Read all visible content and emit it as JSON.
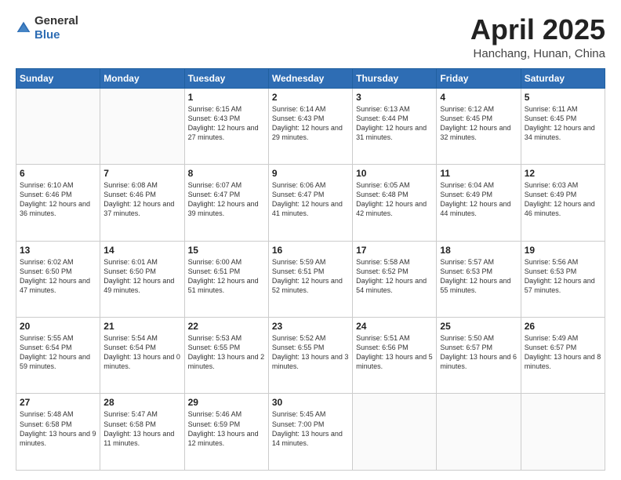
{
  "header": {
    "logo_general": "General",
    "logo_blue": "Blue",
    "title": "April 2025",
    "location": "Hanchang, Hunan, China"
  },
  "weekdays": [
    "Sunday",
    "Monday",
    "Tuesday",
    "Wednesday",
    "Thursday",
    "Friday",
    "Saturday"
  ],
  "weeks": [
    [
      {
        "day": "",
        "sunrise": "",
        "sunset": "",
        "daylight": "",
        "empty": true
      },
      {
        "day": "",
        "sunrise": "",
        "sunset": "",
        "daylight": "",
        "empty": true
      },
      {
        "day": "1",
        "sunrise": "Sunrise: 6:15 AM",
        "sunset": "Sunset: 6:43 PM",
        "daylight": "Daylight: 12 hours and 27 minutes."
      },
      {
        "day": "2",
        "sunrise": "Sunrise: 6:14 AM",
        "sunset": "Sunset: 6:43 PM",
        "daylight": "Daylight: 12 hours and 29 minutes."
      },
      {
        "day": "3",
        "sunrise": "Sunrise: 6:13 AM",
        "sunset": "Sunset: 6:44 PM",
        "daylight": "Daylight: 12 hours and 31 minutes."
      },
      {
        "day": "4",
        "sunrise": "Sunrise: 6:12 AM",
        "sunset": "Sunset: 6:45 PM",
        "daylight": "Daylight: 12 hours and 32 minutes."
      },
      {
        "day": "5",
        "sunrise": "Sunrise: 6:11 AM",
        "sunset": "Sunset: 6:45 PM",
        "daylight": "Daylight: 12 hours and 34 minutes."
      }
    ],
    [
      {
        "day": "6",
        "sunrise": "Sunrise: 6:10 AM",
        "sunset": "Sunset: 6:46 PM",
        "daylight": "Daylight: 12 hours and 36 minutes."
      },
      {
        "day": "7",
        "sunrise": "Sunrise: 6:08 AM",
        "sunset": "Sunset: 6:46 PM",
        "daylight": "Daylight: 12 hours and 37 minutes."
      },
      {
        "day": "8",
        "sunrise": "Sunrise: 6:07 AM",
        "sunset": "Sunset: 6:47 PM",
        "daylight": "Daylight: 12 hours and 39 minutes."
      },
      {
        "day": "9",
        "sunrise": "Sunrise: 6:06 AM",
        "sunset": "Sunset: 6:47 PM",
        "daylight": "Daylight: 12 hours and 41 minutes."
      },
      {
        "day": "10",
        "sunrise": "Sunrise: 6:05 AM",
        "sunset": "Sunset: 6:48 PM",
        "daylight": "Daylight: 12 hours and 42 minutes."
      },
      {
        "day": "11",
        "sunrise": "Sunrise: 6:04 AM",
        "sunset": "Sunset: 6:49 PM",
        "daylight": "Daylight: 12 hours and 44 minutes."
      },
      {
        "day": "12",
        "sunrise": "Sunrise: 6:03 AM",
        "sunset": "Sunset: 6:49 PM",
        "daylight": "Daylight: 12 hours and 46 minutes."
      }
    ],
    [
      {
        "day": "13",
        "sunrise": "Sunrise: 6:02 AM",
        "sunset": "Sunset: 6:50 PM",
        "daylight": "Daylight: 12 hours and 47 minutes."
      },
      {
        "day": "14",
        "sunrise": "Sunrise: 6:01 AM",
        "sunset": "Sunset: 6:50 PM",
        "daylight": "Daylight: 12 hours and 49 minutes."
      },
      {
        "day": "15",
        "sunrise": "Sunrise: 6:00 AM",
        "sunset": "Sunset: 6:51 PM",
        "daylight": "Daylight: 12 hours and 51 minutes."
      },
      {
        "day": "16",
        "sunrise": "Sunrise: 5:59 AM",
        "sunset": "Sunset: 6:51 PM",
        "daylight": "Daylight: 12 hours and 52 minutes."
      },
      {
        "day": "17",
        "sunrise": "Sunrise: 5:58 AM",
        "sunset": "Sunset: 6:52 PM",
        "daylight": "Daylight: 12 hours and 54 minutes."
      },
      {
        "day": "18",
        "sunrise": "Sunrise: 5:57 AM",
        "sunset": "Sunset: 6:53 PM",
        "daylight": "Daylight: 12 hours and 55 minutes."
      },
      {
        "day": "19",
        "sunrise": "Sunrise: 5:56 AM",
        "sunset": "Sunset: 6:53 PM",
        "daylight": "Daylight: 12 hours and 57 minutes."
      }
    ],
    [
      {
        "day": "20",
        "sunrise": "Sunrise: 5:55 AM",
        "sunset": "Sunset: 6:54 PM",
        "daylight": "Daylight: 12 hours and 59 minutes."
      },
      {
        "day": "21",
        "sunrise": "Sunrise: 5:54 AM",
        "sunset": "Sunset: 6:54 PM",
        "daylight": "Daylight: 13 hours and 0 minutes."
      },
      {
        "day": "22",
        "sunrise": "Sunrise: 5:53 AM",
        "sunset": "Sunset: 6:55 PM",
        "daylight": "Daylight: 13 hours and 2 minutes."
      },
      {
        "day": "23",
        "sunrise": "Sunrise: 5:52 AM",
        "sunset": "Sunset: 6:55 PM",
        "daylight": "Daylight: 13 hours and 3 minutes."
      },
      {
        "day": "24",
        "sunrise": "Sunrise: 5:51 AM",
        "sunset": "Sunset: 6:56 PM",
        "daylight": "Daylight: 13 hours and 5 minutes."
      },
      {
        "day": "25",
        "sunrise": "Sunrise: 5:50 AM",
        "sunset": "Sunset: 6:57 PM",
        "daylight": "Daylight: 13 hours and 6 minutes."
      },
      {
        "day": "26",
        "sunrise": "Sunrise: 5:49 AM",
        "sunset": "Sunset: 6:57 PM",
        "daylight": "Daylight: 13 hours and 8 minutes."
      }
    ],
    [
      {
        "day": "27",
        "sunrise": "Sunrise: 5:48 AM",
        "sunset": "Sunset: 6:58 PM",
        "daylight": "Daylight: 13 hours and 9 minutes."
      },
      {
        "day": "28",
        "sunrise": "Sunrise: 5:47 AM",
        "sunset": "Sunset: 6:58 PM",
        "daylight": "Daylight: 13 hours and 11 minutes."
      },
      {
        "day": "29",
        "sunrise": "Sunrise: 5:46 AM",
        "sunset": "Sunset: 6:59 PM",
        "daylight": "Daylight: 13 hours and 12 minutes."
      },
      {
        "day": "30",
        "sunrise": "Sunrise: 5:45 AM",
        "sunset": "Sunset: 7:00 PM",
        "daylight": "Daylight: 13 hours and 14 minutes."
      },
      {
        "day": "",
        "sunrise": "",
        "sunset": "",
        "daylight": "",
        "empty": true
      },
      {
        "day": "",
        "sunrise": "",
        "sunset": "",
        "daylight": "",
        "empty": true
      },
      {
        "day": "",
        "sunrise": "",
        "sunset": "",
        "daylight": "",
        "empty": true
      }
    ]
  ]
}
